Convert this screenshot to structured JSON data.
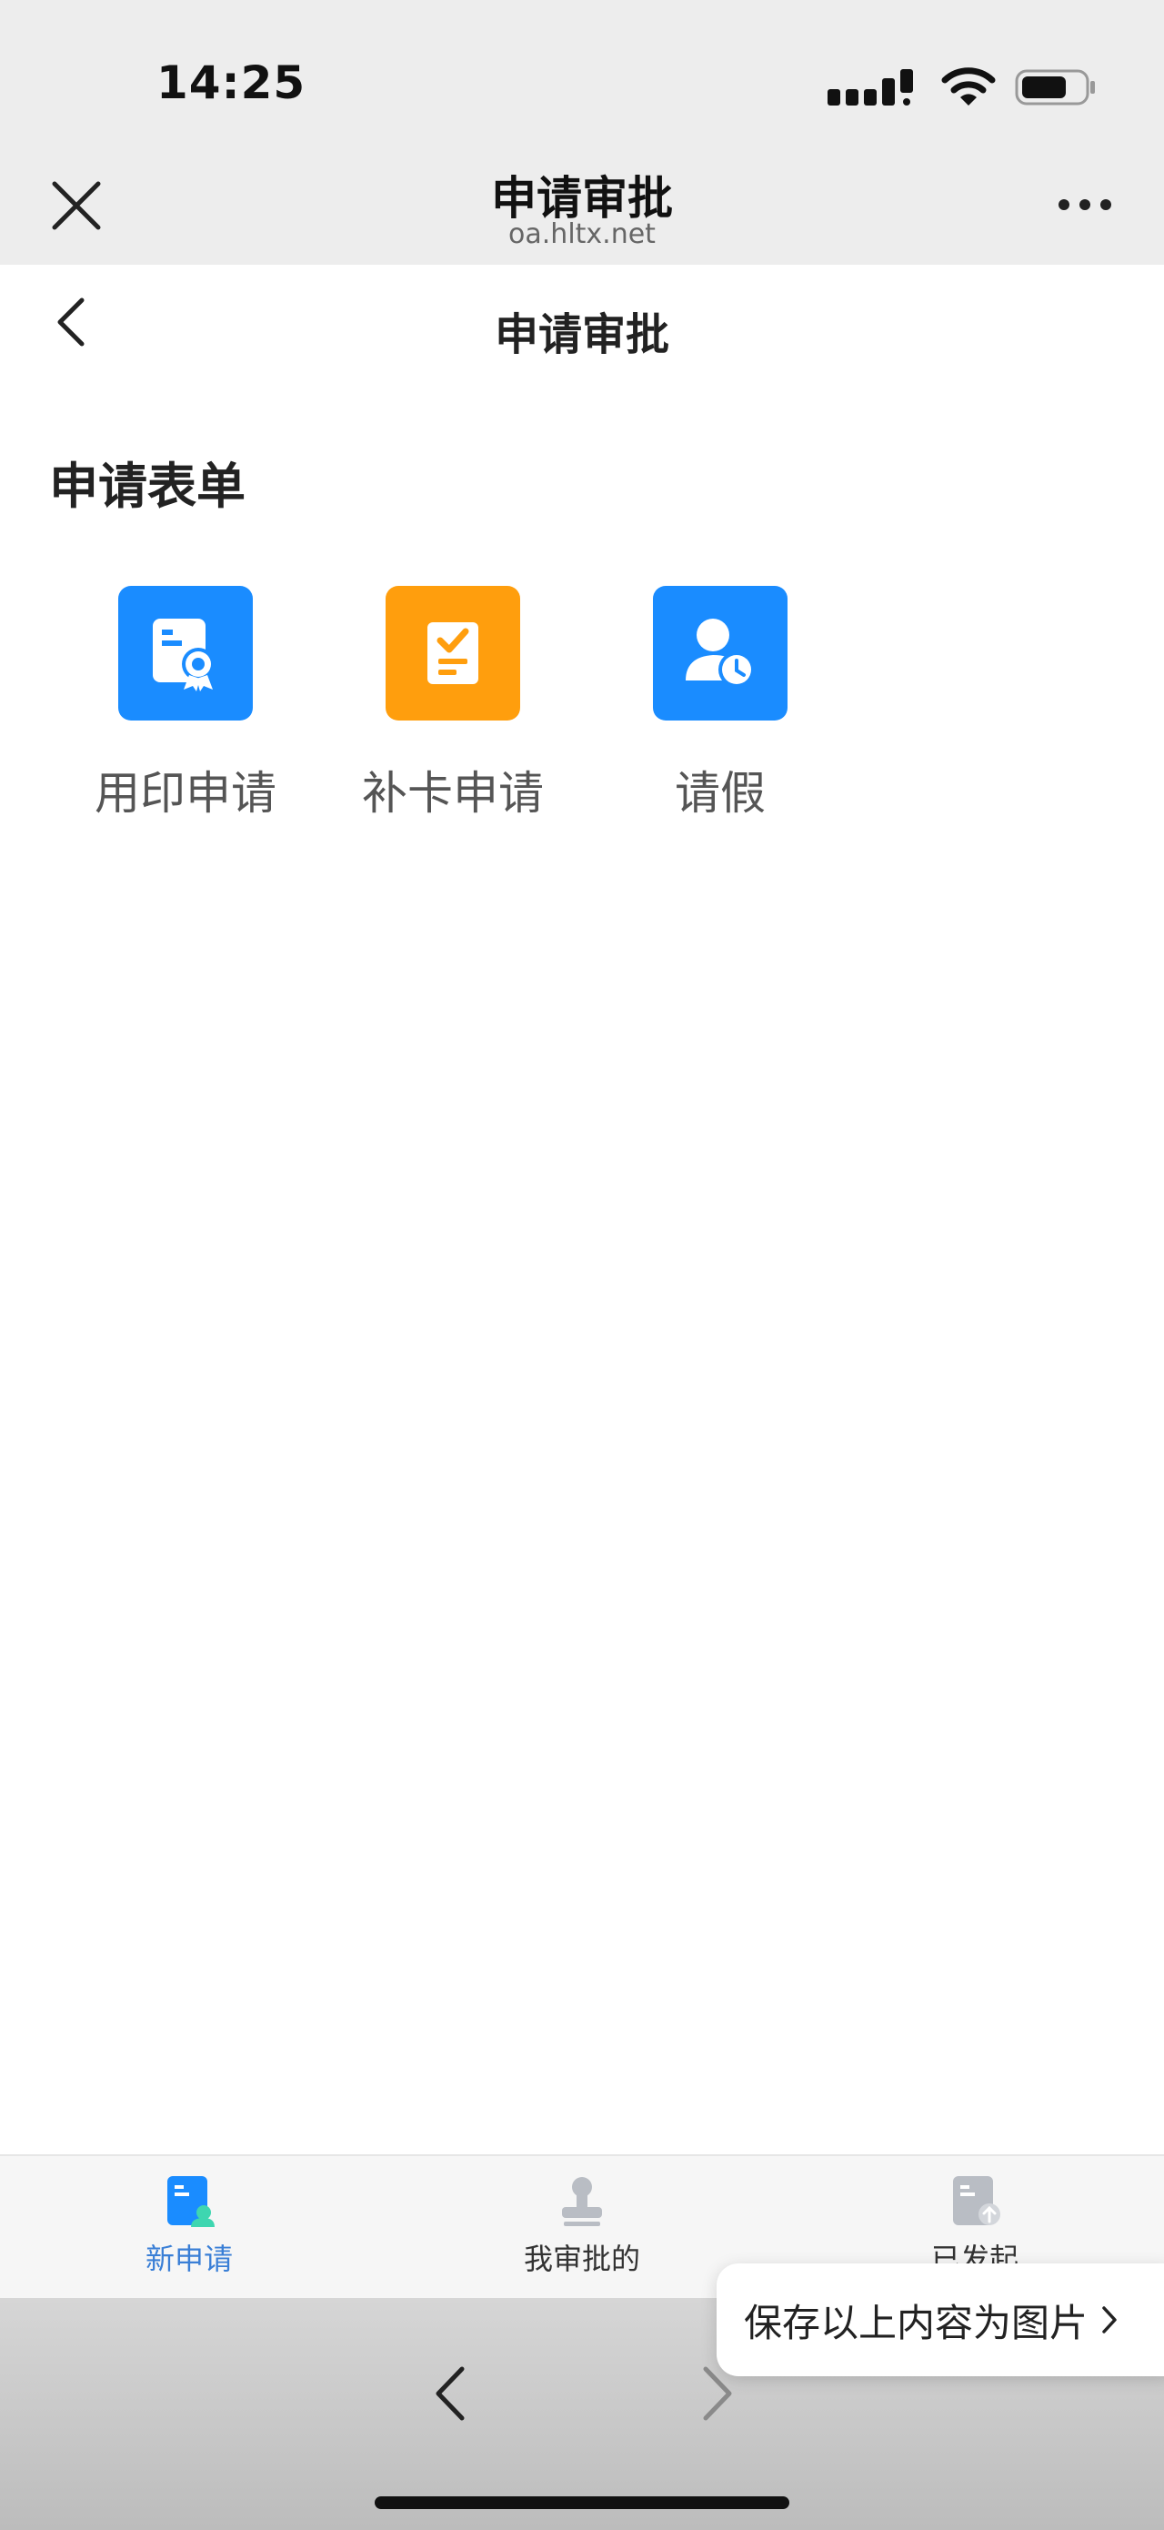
{
  "status_bar": {
    "time": "14:25"
  },
  "browser": {
    "title": "申请审批",
    "url": "oa.hltx.net"
  },
  "page": {
    "title": "申请审批",
    "section_title": "申请表单"
  },
  "forms": [
    {
      "label": "用印申请",
      "color": "#1a8cff",
      "icon": "seal-certificate-icon"
    },
    {
      "label": "补卡申请",
      "color": "#ff9e0d",
      "icon": "checklist-icon"
    },
    {
      "label": "请假",
      "color": "#1a8cff",
      "icon": "user-clock-icon"
    }
  ],
  "tabs": [
    {
      "label": "新申请",
      "active": true,
      "icon": "new-application-icon"
    },
    {
      "label": "我审批的",
      "active": false,
      "icon": "stamp-icon"
    },
    {
      "label": "已发起",
      "active": false,
      "icon": "submitted-icon"
    }
  ],
  "toast": {
    "text": "保存以上内容为图片"
  },
  "colors": {
    "accent": "#3a7fd6",
    "topbar": "#ededed"
  }
}
